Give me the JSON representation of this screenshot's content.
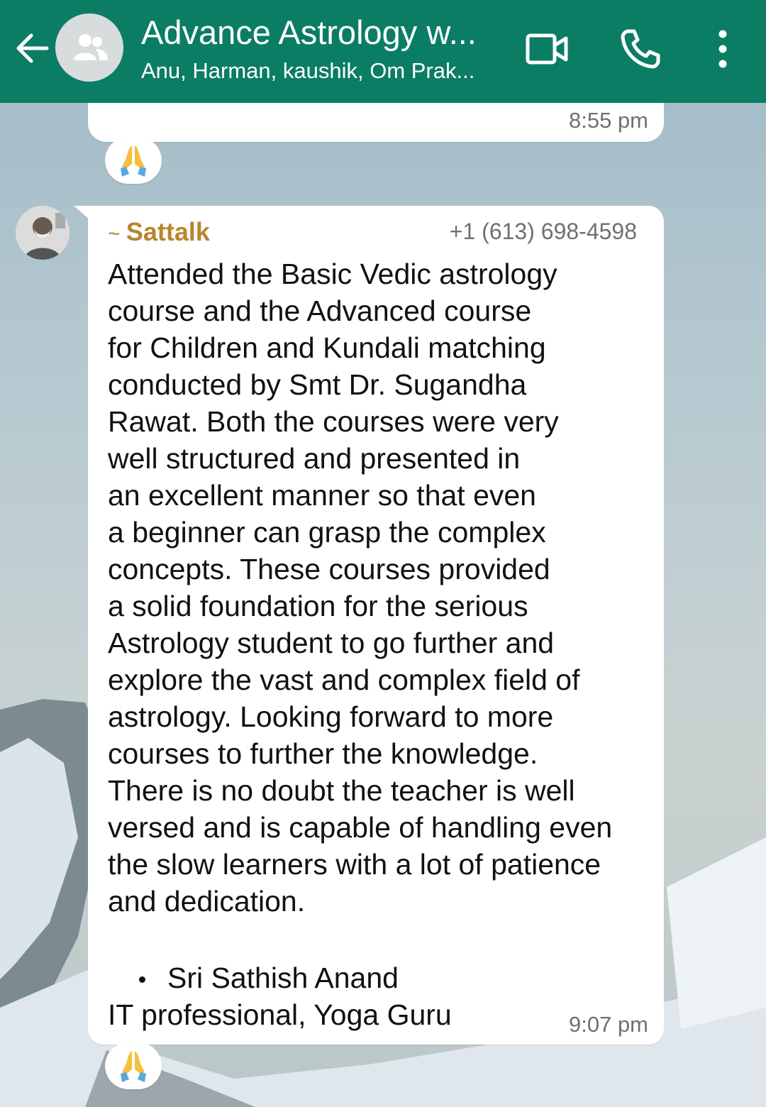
{
  "header": {
    "title": "Advance Astrology w...",
    "subtitle": "Anu, Harman, kaushik, Om Prak...",
    "bg_color": "#0b7d64",
    "icons": [
      "back-arrow-icon",
      "group-avatar-icon",
      "video-call-icon",
      "phone-call-icon",
      "more-options-icon"
    ]
  },
  "previous_message": {
    "time": "8:55 pm",
    "reaction": "🙏"
  },
  "message": {
    "sender_prefix": "~ ",
    "sender_name": "Sattalk",
    "sender_phone": "+1 (613) 698-4598",
    "sender_color": "#b8862e",
    "lines": [
      "Attended the Basic Vedic astrology",
      "course and the Advanced course",
      "for Children and Kundali matching",
      "conducted by Smt Dr. Sugandha",
      "Rawat. Both the courses were very",
      "well structured and presented in",
      "an excellent manner so that even",
      "a beginner can grasp the complex",
      "concepts. These courses provided",
      "a solid foundation for the serious",
      "Astrology student to go further and",
      "explore the vast and complex field of",
      "astrology. Looking forward to more",
      "courses to further the knowledge.",
      "There is no doubt the teacher is well",
      "versed and is capable of handling even",
      "the slow learners with a lot of patience",
      "and dedication."
    ],
    "bullet": "Sri Sathish Anand",
    "footer": "IT professional, Yoga Guru",
    "time": "9:07 pm",
    "reaction": "🙏"
  }
}
